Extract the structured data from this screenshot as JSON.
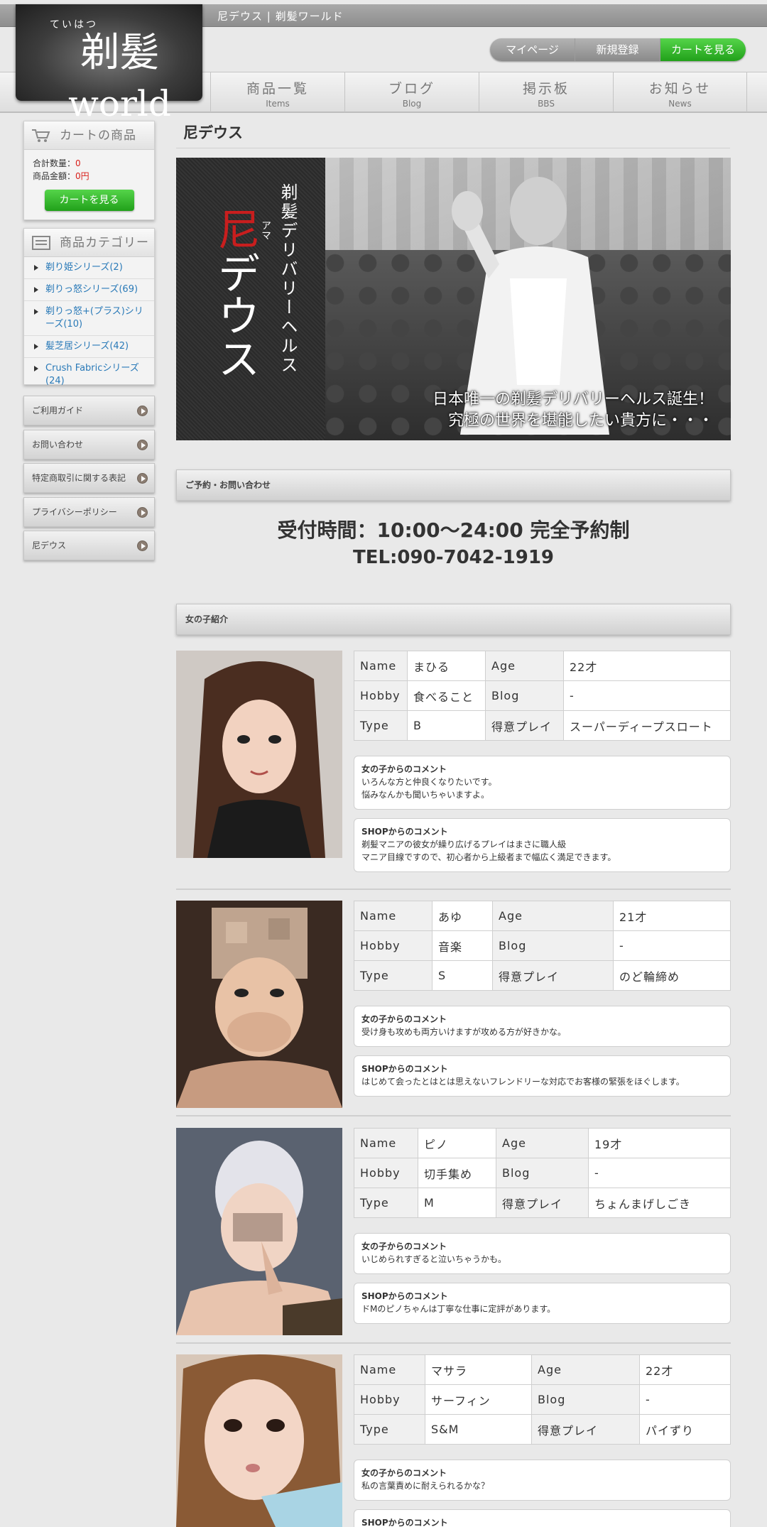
{
  "header": {
    "site_title": "尼デウス | 剃髪ワールド",
    "logo_ruby": "ていはつ",
    "logo_kanji": "剃髪",
    "logo_latin": "world",
    "buttons": {
      "mypage": "マイページ",
      "register": "新規登録",
      "cart": "カートを見る"
    },
    "nav": [
      {
        "jp": "商品一覧",
        "en": "Items"
      },
      {
        "jp": "ブログ",
        "en": "Blog"
      },
      {
        "jp": "掲示板",
        "en": "BBS"
      },
      {
        "jp": "お知らせ",
        "en": "News"
      }
    ]
  },
  "sidebar": {
    "cart": {
      "title": "カートの商品",
      "qty_label": "合計数量：",
      "qty_value": "0",
      "amount_label": "商品金額：",
      "amount_value": "0円",
      "button": "カートを見る"
    },
    "categories": {
      "title": "商品カテゴリー",
      "items": [
        "剃り姫シリーズ(2)",
        "剃りっ怒シリーズ(69)",
        "剃りっ怒+(プラス)シリーズ(10)",
        "髪芝居シリーズ(42)",
        "Crush Fabricシリーズ(24)"
      ]
    },
    "links": [
      "ご利用ガイド",
      "お問い合わせ",
      "特定商取引に関する表記",
      "プライバシーポリシー",
      "尼デウス"
    ]
  },
  "main": {
    "page_title": "尼デウス",
    "hero": {
      "vertical_sub": "剃髪デリバリーヘルス",
      "ruby": "アマ",
      "title_red": "尼",
      "title_rest": "デウス",
      "catch1": "日本唯一の剃髪デリバリーヘルス誕生！",
      "catch2": "究極の世界を堪能したい貴方に・・・"
    },
    "reservation": {
      "heading": "ご予約・お問い合わせ",
      "time": "受付時間：10:00〜24:00 完全予約制",
      "tel": "TEL:090-7042-1919"
    },
    "girls_heading": "女の子紹介",
    "labels": {
      "name": "Name",
      "age": "Age",
      "hobby": "Hobby",
      "blog": "Blog",
      "type": "Type",
      "play": "得意プレイ",
      "girl_comment": "女の子からのコメント",
      "shop_comment": "SHOPからのコメント"
    },
    "girls": [
      {
        "name": "まひる",
        "age": "22才",
        "hobby": "食べること",
        "blog": "-",
        "type": "B",
        "play": "スーパーディープスロート",
        "girl_comment": [
          "いろんな方と仲良くなりたいです。",
          "悩みなんかも聞いちゃいますよ。"
        ],
        "shop_comment": [
          "剃髪マニアの彼女が繰り広げるプレイはまさに職人級",
          "マニア目線ですので、初心者から上級者まで幅広く満足できます。"
        ]
      },
      {
        "name": "あゆ",
        "age": "21才",
        "hobby": "音楽",
        "blog": "-",
        "type": "S",
        "play": "のど輪締め",
        "girl_comment": [
          "受け身も攻めも両方いけますが攻める方が好きかな。"
        ],
        "shop_comment": [
          "はじめて会ったとはとは思えないフレンドリーな対応でお客様の緊張をほぐします。"
        ]
      },
      {
        "name": "ピノ",
        "age": "19才",
        "hobby": "切手集め",
        "blog": "-",
        "type": "M",
        "play": "ちょんまげしごき",
        "girl_comment": [
          "いじめられすぎると泣いちゃうかも。"
        ],
        "shop_comment": [
          "ドMのピノちゃんは丁寧な仕事に定評があります。"
        ]
      },
      {
        "name": "マサラ",
        "age": "22才",
        "hobby": "サーフィン",
        "blog": "-",
        "type": "S&M",
        "play": "パイずり",
        "girl_comment": [
          "私の言葉責めに耐えられるかな？"
        ],
        "shop_comment": []
      }
    ]
  }
}
